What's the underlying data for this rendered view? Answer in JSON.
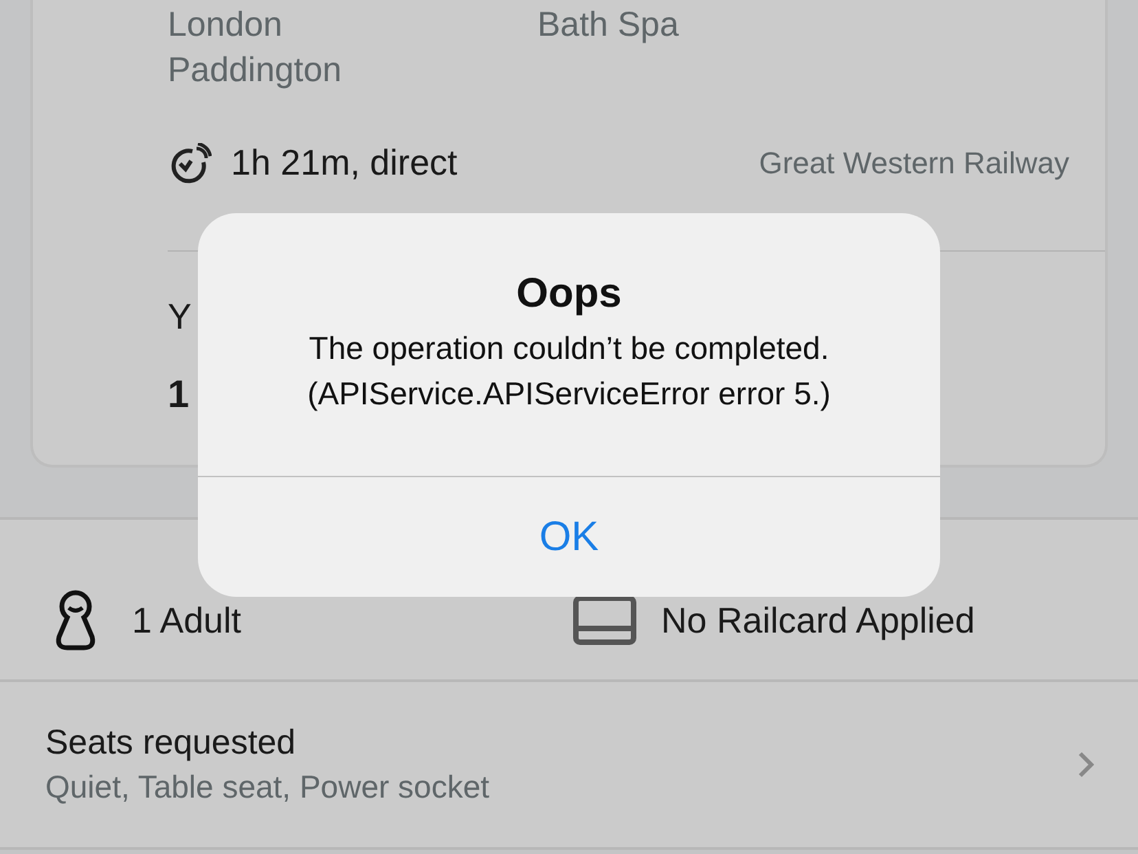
{
  "journey": {
    "origin": "London\nPaddington",
    "destination": "Bath Spa",
    "duration": "1h 21m, direct",
    "operator": "Great Western Railway",
    "label_partial": "Y",
    "price_partial": "1"
  },
  "passengers": {
    "count": "1 Adult",
    "railcard": "No Railcard Applied"
  },
  "seats": {
    "title": "Seats requested",
    "options": "Quiet, Table seat, Power socket"
  },
  "alert": {
    "title": "Oops",
    "message": "The operation couldn’t be completed.\n(APIService.APIServiceError error 5.)",
    "buttons": [
      "OK"
    ]
  }
}
